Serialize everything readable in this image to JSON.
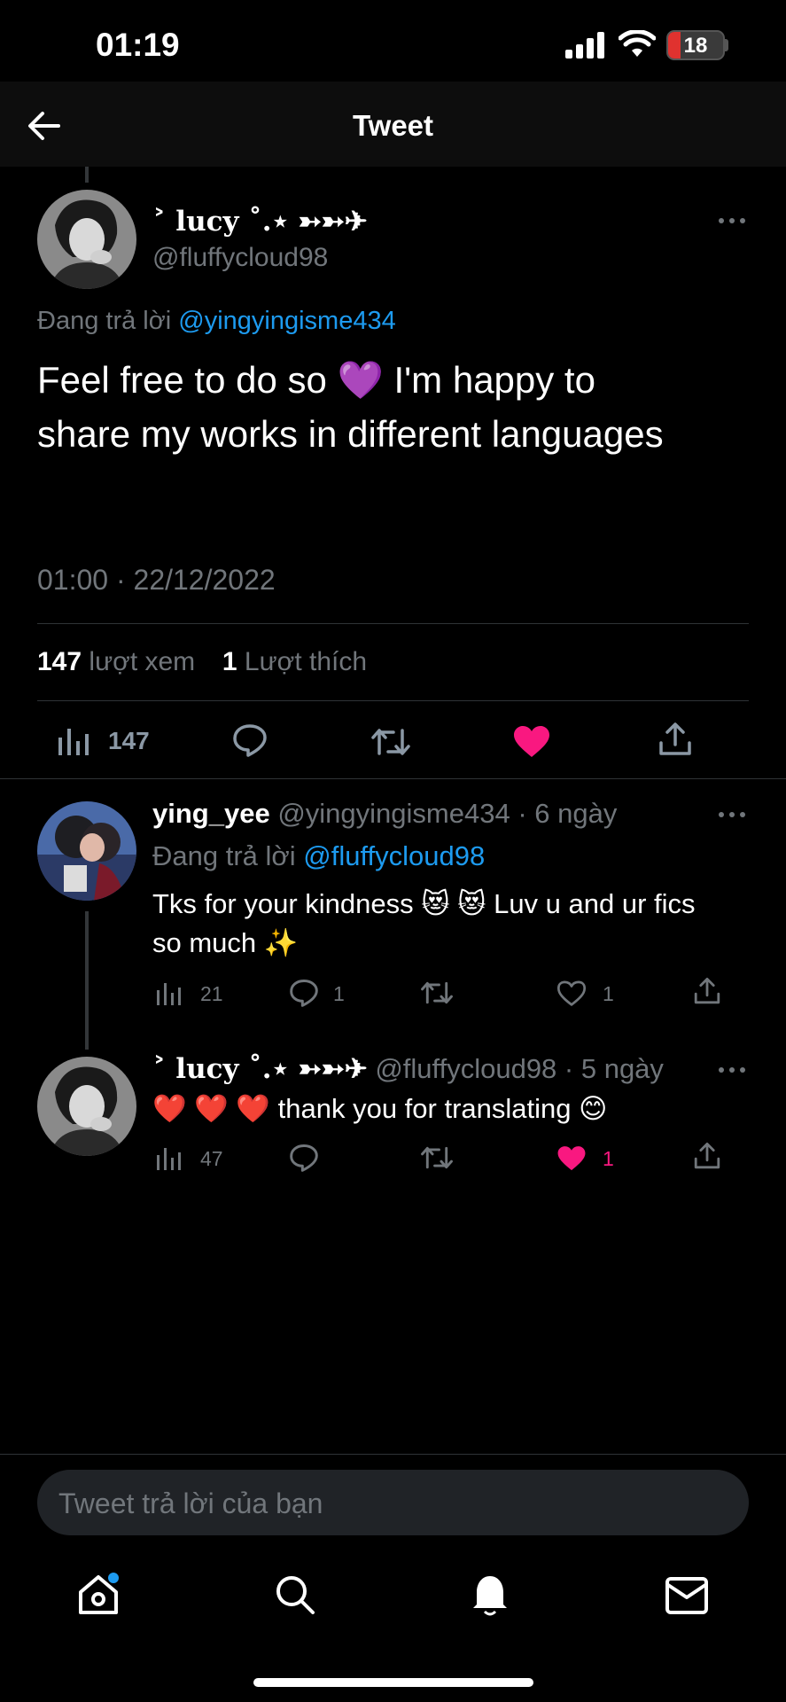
{
  "status_bar": {
    "time": "01:19",
    "battery": "18"
  },
  "header": {
    "title": "Tweet"
  },
  "main_tweet": {
    "display_name": "˃ lucy ˚.⋆ ➳➳✈",
    "handle": "@fluffycloud98",
    "replying_to_label": "Đang trả lời",
    "replying_to_handle": "@yingyingisme434",
    "text_line1": "Feel free to do so 💜 I'm happy to",
    "text_line2": "share my works in different languages",
    "timestamp": "01:00 · 22/12/2022",
    "views_count": "147",
    "views_label": "lượt xem",
    "likes_count": "1",
    "likes_label": "Lượt thích",
    "action_views": "147"
  },
  "replies": [
    {
      "display_name": "ying_yee",
      "handle_time": "@yingyingisme434 · 6 ngày",
      "replying_to_label": "Đang trả lời",
      "replying_to_handle": "@fluffycloud98",
      "text_line1": "Tks for your kindness 😻 😻 Luv u and ur fics",
      "text_line2": "so much ✨",
      "views": "21",
      "replies": "1",
      "likes": "1"
    },
    {
      "display_name": "˃ lucy ˚.⋆ ➳➳✈",
      "handle_time": "@fluffycloud98 · 5 ngày",
      "text_line1": "❤️ ❤️ ❤️ thank you for translating 😊",
      "views": "47",
      "likes": "1"
    }
  ],
  "composer": {
    "placeholder": "Tweet trả lời của bạn"
  },
  "colors": {
    "accent": "#1d9bf0",
    "like": "#f91880",
    "background": "#000000"
  }
}
